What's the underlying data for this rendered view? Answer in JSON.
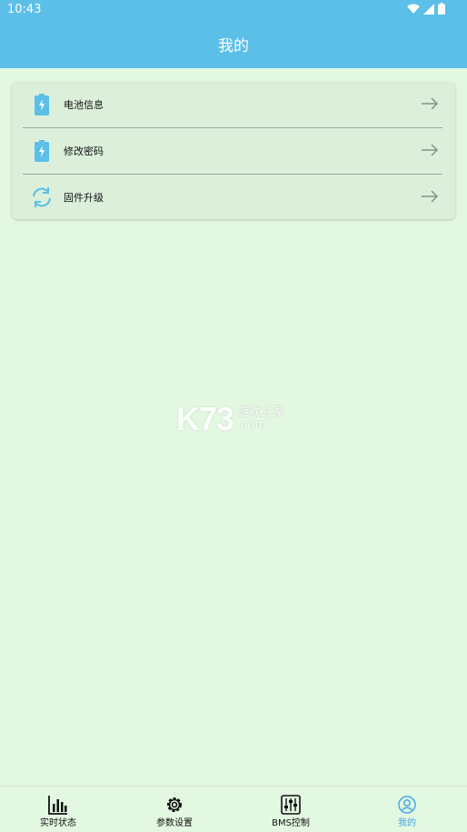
{
  "status": {
    "time": "10:43"
  },
  "header": {
    "title": "我的"
  },
  "menu": {
    "items": [
      {
        "label": "电池信息",
        "icon": "battery-icon"
      },
      {
        "label": "修改密码",
        "icon": "battery-icon"
      },
      {
        "label": "固件升级",
        "icon": "refresh-icon"
      }
    ]
  },
  "watermark": {
    "main": "K73",
    "sub_cn": "游戏之家",
    "sub_en": ".com"
  },
  "tabbar": {
    "tabs": [
      {
        "label": "实时状态",
        "icon": "bar-chart-icon"
      },
      {
        "label": "参数设置",
        "icon": "gear-icon"
      },
      {
        "label": "BMS控制",
        "icon": "sliders-icon"
      },
      {
        "label": "我的",
        "icon": "user-icon"
      }
    ],
    "active_color": "#46a7e3"
  },
  "colors": {
    "header": "#5bbfe8",
    "background": "#e2f8e1",
    "accent": "#46a7e3"
  }
}
